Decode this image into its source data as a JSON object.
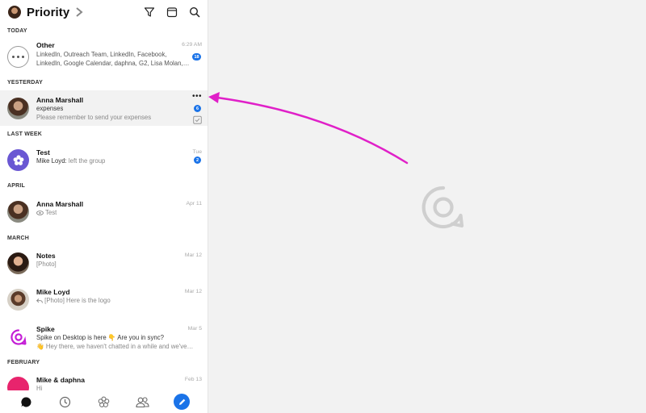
{
  "header": {
    "title": "Priority"
  },
  "sections": {
    "today": "TODAY",
    "yesterday": "YESTERDAY",
    "last_week": "LAST WEEK",
    "april": "APRIL",
    "march": "MARCH",
    "february": "FEBRUARY"
  },
  "conversations": [
    {
      "name": "Other",
      "line1": "LinkedIn, Outreach Team, LinkedIn, Facebook,",
      "line2": "LinkedIn, Google Calendar, daphna, G2, Lisa Molan,…",
      "time": "6:29 AM",
      "badge": "18",
      "icon": "more-dots-icon"
    },
    {
      "name": "Anna Marshall",
      "line1": "expenses",
      "line2": "Please remember to send your expenses",
      "time": "",
      "badge": "6",
      "icon": "avatar-photo"
    },
    {
      "name": "Test",
      "line1_sender": "Mike Loyd:",
      "line1": "left the group",
      "time": "Tue",
      "badge": "2",
      "icon": "group-flower-icon"
    },
    {
      "name": "Anna Marshall",
      "line1": "Test",
      "time": "Apr 11",
      "icon": "eye-icon"
    },
    {
      "name": "Notes",
      "line1": "[Photo]",
      "time": "Mar 12",
      "icon": "avatar-photo"
    },
    {
      "name": "Mike Loyd",
      "line1": "[Photo] Here is the logo",
      "time": "Mar 12",
      "icon": "reply-icon"
    },
    {
      "name": "Spike",
      "line1": "Spike on Desktop is here 👇 Are you in sync?",
      "line2": "👋 Hey there, we haven't chatted in a while and we've…",
      "time": "Mar 5",
      "icon": "spike-logo-icon"
    },
    {
      "name": "Mike & daphna",
      "line1": "Hi",
      "time": "Feb 13",
      "icon": "group-avatar"
    }
  ],
  "bottom_nav": [
    "chat-icon",
    "clock-icon",
    "groups-flower-icon",
    "contacts-icon",
    "compose-icon"
  ],
  "colors": {
    "accent": "#1a73e8",
    "annotation_arrow": "#e020c8",
    "test_group": "#6a57d3",
    "spike_brand": "#c41fd6"
  }
}
